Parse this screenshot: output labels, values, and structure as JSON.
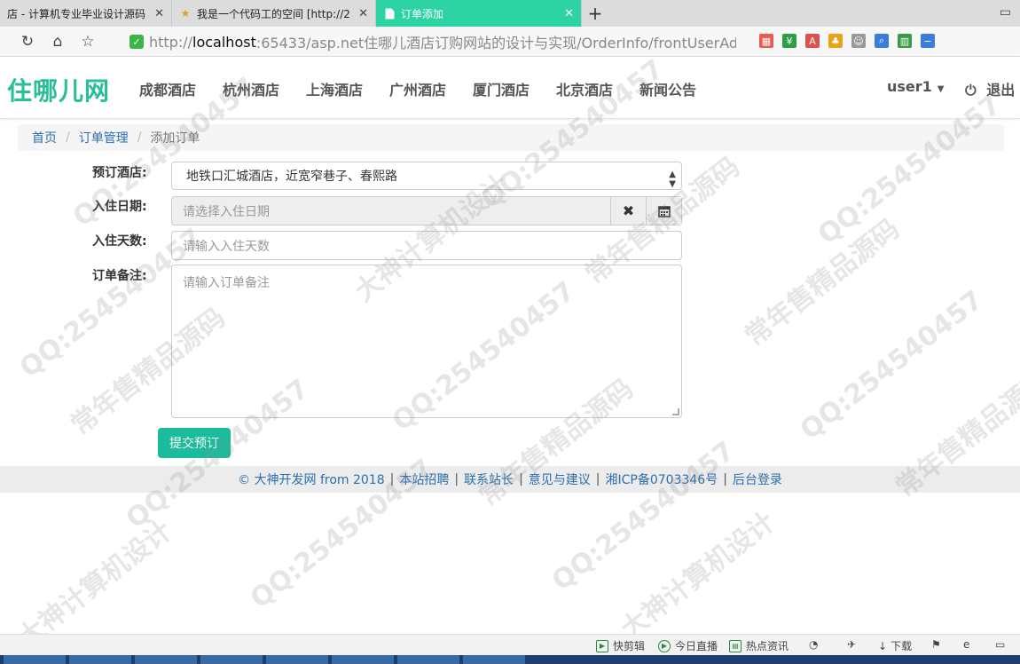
{
  "browser": {
    "tabs": [
      {
        "title": "店 - 计算机专业毕业设计源码",
        "active": false
      },
      {
        "title": "我是一个代码工的空间 [http://2",
        "active": false
      },
      {
        "title": "订单添加",
        "active": true
      }
    ],
    "url": {
      "proto": "http://",
      "host": "localhost",
      "rest": ":65433/asp.net住哪儿酒店订购网站的设计与实现/OrderInfo/frontUserAd"
    }
  },
  "site": {
    "brand": "住哪儿网",
    "nav": [
      "成都酒店",
      "杭州酒店",
      "上海酒店",
      "广州酒店",
      "厦门酒店",
      "北京酒店",
      "新闻公告"
    ],
    "user": "user1",
    "logout": "退出"
  },
  "breadcrumb": {
    "home": "首页",
    "section": "订单管理",
    "current": "添加订单"
  },
  "form": {
    "hotel_label": "预订酒店:",
    "hotel_value": "地铁口汇城酒店，近宽窄巷子、春熙路",
    "date_label": "入住日期:",
    "date_placeholder": "请选择入住日期",
    "days_label": "入住天数:",
    "days_placeholder": "请输入入住天数",
    "note_label": "订单备注:",
    "note_placeholder": "请输入订单备注",
    "submit": "提交预订"
  },
  "footer": {
    "copyright": "© 大神开发网 from 2018",
    "links": [
      "本站招聘",
      "联系站长",
      "意见与建议",
      "湘ICP备0703346号",
      "后台登录"
    ]
  },
  "statusbar": [
    "快剪辑",
    "今日直播",
    "热点资讯",
    "下载"
  ],
  "watermark": [
    "QQ:254540457",
    "常年售精品源码",
    "大神计算机设计"
  ]
}
